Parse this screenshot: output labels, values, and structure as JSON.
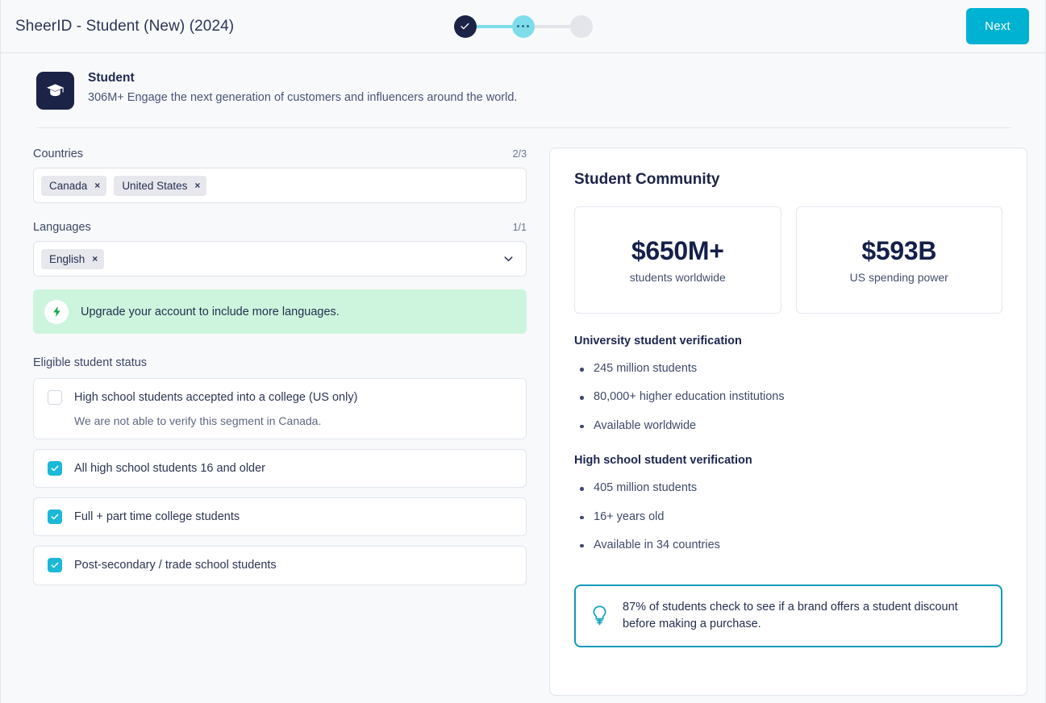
{
  "header": {
    "title": "SheerID - Student (New) (2024)",
    "next_label": "Next",
    "steps": [
      {
        "state": "done",
        "icon": "check-icon"
      },
      {
        "state": "current",
        "icon": "ellipsis-icon"
      },
      {
        "state": "todo",
        "icon": ""
      }
    ]
  },
  "program": {
    "icon": "graduation-cap-icon",
    "name": "Student",
    "description": "306M+ Engage the next generation of customers and influencers around the world."
  },
  "form": {
    "countries": {
      "label": "Countries",
      "count": "2/3",
      "tags": [
        {
          "label": "Canada",
          "remove": "×"
        },
        {
          "label": "United States",
          "remove": "×"
        }
      ]
    },
    "languages": {
      "label": "Languages",
      "count": "1/1",
      "tags": [
        {
          "label": "English",
          "remove": "×"
        }
      ]
    },
    "upgrade_banner": {
      "icon": "lightning-bolt-icon",
      "text": "Upgrade your account to include more languages."
    },
    "eligible_status": {
      "label": "Eligible student status",
      "options": [
        {
          "label": "High school students accepted into a college (US only)",
          "checked": false,
          "note": "We are not able to verify this segment in Canada."
        },
        {
          "label": "All high school students 16 and older",
          "checked": true,
          "note": ""
        },
        {
          "label": "Full + part time college students",
          "checked": true,
          "note": ""
        },
        {
          "label": "Post-secondary / trade school students",
          "checked": true,
          "note": ""
        }
      ]
    }
  },
  "info_panel": {
    "title": "Student Community",
    "stats": [
      {
        "value": "$650M+",
        "label": "students worldwide"
      },
      {
        "value": "$593B",
        "label": "US spending power"
      }
    ],
    "sections": [
      {
        "heading": "University student verification",
        "items": [
          "245 million students",
          "80,000+ higher education institutions",
          "Available worldwide"
        ]
      },
      {
        "heading": "High school student verification",
        "items": [
          "405 million students",
          "16+ years old",
          "Available in 34 countries"
        ]
      }
    ],
    "tip": {
      "icon": "lightbulb-icon",
      "text": "87% of students check to see if a brand offers a student discount before making a purchase."
    }
  },
  "colors": {
    "accent_cyan": "#00b2d1",
    "navy": "#1b2347",
    "step_current": "#7fdcea",
    "banner_green": "#cdf5dd",
    "bolt_green": "#15a94b",
    "tip_border": "#0f9cb8",
    "page_bg": "#f7f9fb"
  }
}
